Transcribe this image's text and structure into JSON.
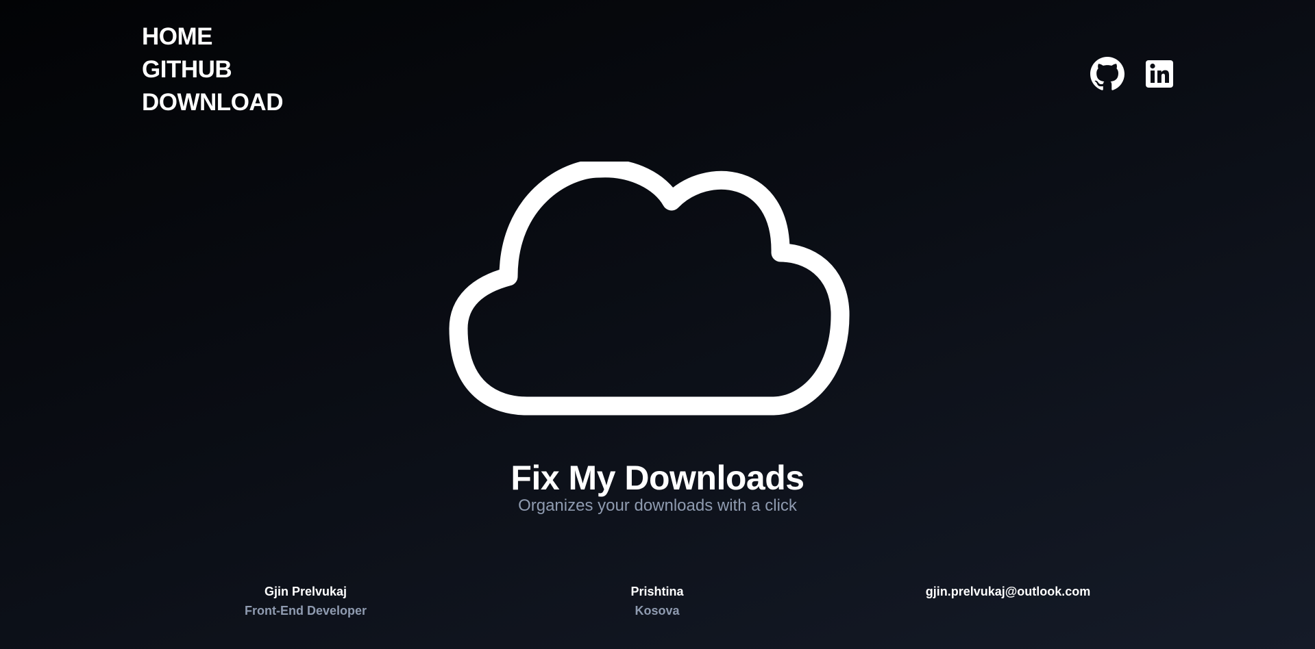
{
  "nav": {
    "items": [
      {
        "label": "HOME"
      },
      {
        "label": "GITHUB"
      },
      {
        "label": "DOWNLOAD"
      }
    ]
  },
  "social": {
    "github_icon": "github-icon",
    "linkedin_icon": "linkedin-icon"
  },
  "hero": {
    "icon": "cloud-icon",
    "title": "Fix My Downloads",
    "subtitle": "Organizes your downloads with a click"
  },
  "footer": {
    "author": {
      "name": "Gjin Prelvukaj",
      "role": "Front-End Developer"
    },
    "location": {
      "city": "Prishtina",
      "country": "Kosova"
    },
    "contact": {
      "email": "gjin.prelvukaj@outlook.com"
    }
  },
  "colors": {
    "background_top": "#020305",
    "background_bottom": "#151b28",
    "text_primary": "#ffffff",
    "text_secondary": "#8f9bb0"
  }
}
